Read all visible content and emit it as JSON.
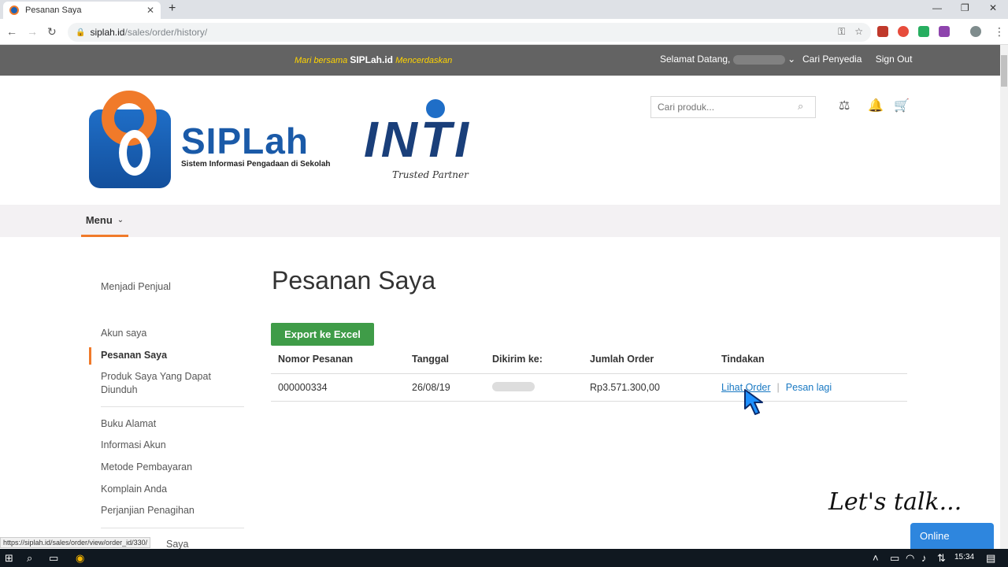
{
  "browser": {
    "tab_title": "Pesanan Saya",
    "tab_close": "✕",
    "new_tab": "+",
    "url_host": "siplah.id",
    "url_path": "/sales/order/history/",
    "status_url": "https://siplah.id/sales/order/view/order_id/330/"
  },
  "topbar": {
    "tagline_pre": "Mari bersama",
    "tagline_brand": "SIPLah.id",
    "tagline_post": "Mencerdaskan",
    "welcome": "Selamat Datang,",
    "find_supplier": "Cari Penyedia",
    "sign_out": "Sign Out"
  },
  "header": {
    "logo_name": "SIPLah",
    "logo_subtitle": "Sistem Informasi Pengadaan di Sekolah",
    "partner_name": "INTI",
    "partner_tagline": "Trusted Partner",
    "search_placeholder": "Cari produk..."
  },
  "menu": {
    "label": "Menu"
  },
  "sidebar": {
    "items": [
      "Menjadi Penjual",
      "Akun saya",
      "Pesanan Saya",
      "Produk Saya Yang Dapat Diunduh",
      "Buku Alamat",
      "Informasi Akun",
      "Metode Pembayaran",
      "Komplain Anda",
      "Perjanjian Penagihan",
      "Saya"
    ]
  },
  "main": {
    "title": "Pesanan Saya",
    "export_label": "Export ke Excel",
    "columns": [
      "Nomor Pesanan",
      "Tanggal",
      "Dikirim ke:",
      "Jumlah Order",
      "Tindakan"
    ],
    "rows": [
      {
        "order_no": "000000334",
        "date": "26/08/19",
        "total": "Rp3.571.300,00",
        "view_label": "Lihat Order",
        "reorder_label": "Pesan lagi"
      }
    ],
    "action_separator": "|"
  },
  "chat": {
    "lets_talk": "Let's talk...",
    "online": "Online"
  },
  "taskbar": {
    "time": "15:34"
  },
  "colors": {
    "accent_orange": "#f07a2a",
    "brand_blue": "#1a5aa8",
    "export_green": "#3f9c48",
    "link_blue": "#1979c3",
    "topbar_gray": "#636363"
  }
}
